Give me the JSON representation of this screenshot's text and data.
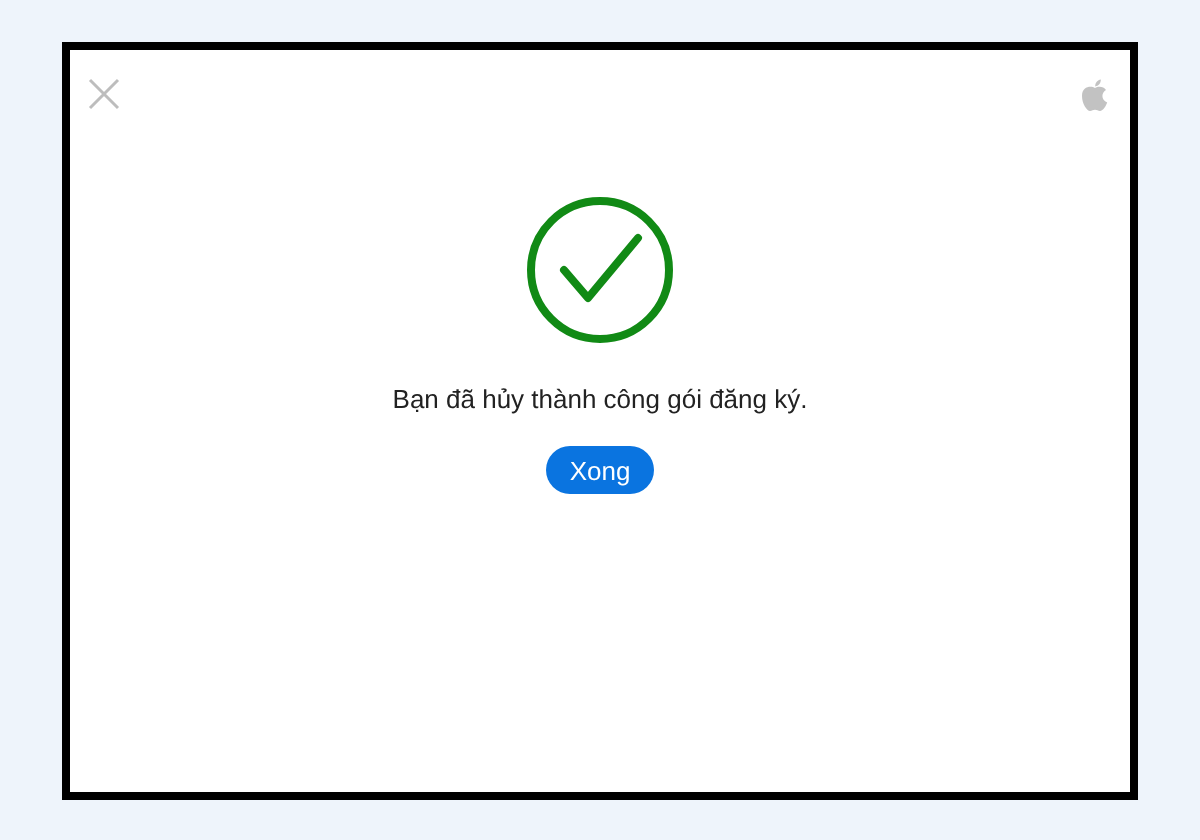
{
  "dialog": {
    "message": "Bạn đã hủy thành công gói đăng ký.",
    "button": "Xong"
  }
}
